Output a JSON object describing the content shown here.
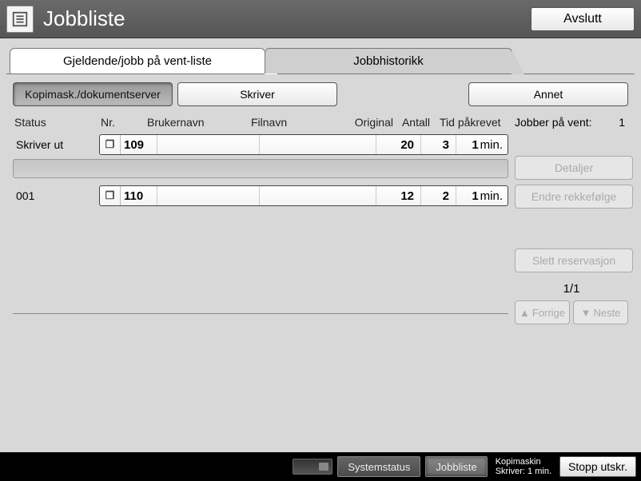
{
  "titlebar": {
    "title": "Jobbliste",
    "exit": "Avslutt"
  },
  "tabs": {
    "current": "Gjeldende/jobb på vent-liste",
    "history": "Jobbhistorikk"
  },
  "toolbar": {
    "kopi": "Kopimask./dokumentserver",
    "skriver": "Skriver",
    "annet": "Annet"
  },
  "headers": {
    "status": "Status",
    "nr": "Nr.",
    "user": "Brukernavn",
    "file": "Filnavn",
    "original": "Original",
    "count": "Antall",
    "time": "Tid påkrevet"
  },
  "side": {
    "pending_label": "Jobber på vent:",
    "pending_count": "1",
    "details": "Detaljer",
    "reorder": "Endre rekkefølge",
    "delete": "Slett reservasjon",
    "page": "1/1",
    "prev": "Forrige",
    "next": "Neste"
  },
  "jobs": {
    "printing_status": "Skriver ut",
    "row1": {
      "nr": "109",
      "original": "20",
      "count": "3",
      "time_val": "1",
      "time_unit": "min."
    },
    "row2_status": "001",
    "row2": {
      "nr": "110",
      "original": "12",
      "count": "2",
      "time_val": "1",
      "time_unit": "min."
    }
  },
  "footer": {
    "system": "Systemstatus",
    "joblist": "Jobbliste",
    "status1": "Kopimaskin",
    "status2": "Skriver: 1 min.",
    "stop": "Stopp utskr."
  }
}
